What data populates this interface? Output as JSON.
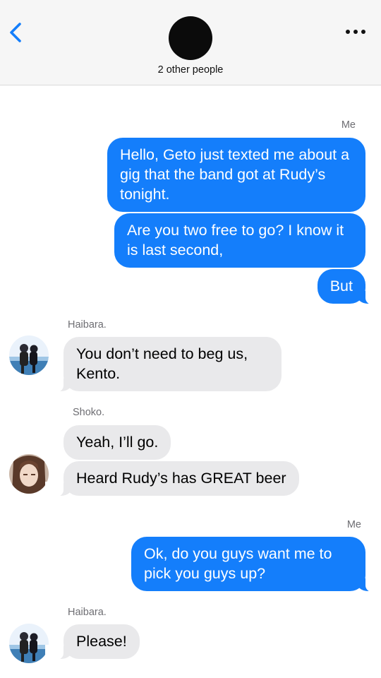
{
  "header": {
    "subtitle": "2 other people",
    "icons": {
      "back": "chevron-left-icon",
      "more": "ellipsis-icon"
    },
    "accent_color": "#147efb"
  },
  "messages": [
    {
      "sender": "Me",
      "direction": "outgoing",
      "show_sender": true,
      "bubbles": [
        "Hello, Geto just texted me about a gig that the band got at Rudy’s tonight.",
        "Are you two free to go? I know it is last second,",
        "But"
      ]
    },
    {
      "sender": "Haibara.",
      "direction": "incoming",
      "show_sender": true,
      "avatar": "haibara-avatar",
      "bubbles": [
        "You don’t need to beg us, Kento."
      ]
    },
    {
      "sender": "Shoko.",
      "direction": "incoming",
      "show_sender": true,
      "avatar": "shoko-avatar",
      "bubbles": [
        "Yeah, I’ll go.",
        "Heard Rudy’s has GREAT beer"
      ]
    },
    {
      "sender": "Me",
      "direction": "outgoing",
      "show_sender": true,
      "bubbles": [
        "Ok, do you guys want me to pick you guys up?"
      ]
    },
    {
      "sender": "Haibara.",
      "direction": "incoming",
      "show_sender": true,
      "avatar": "haibara-avatar",
      "bubbles": [
        "Please!"
      ]
    }
  ],
  "colors": {
    "outgoing_bubble": "#147efb",
    "incoming_bubble": "#e9e9eb",
    "sender_label": "#6d6d72"
  }
}
